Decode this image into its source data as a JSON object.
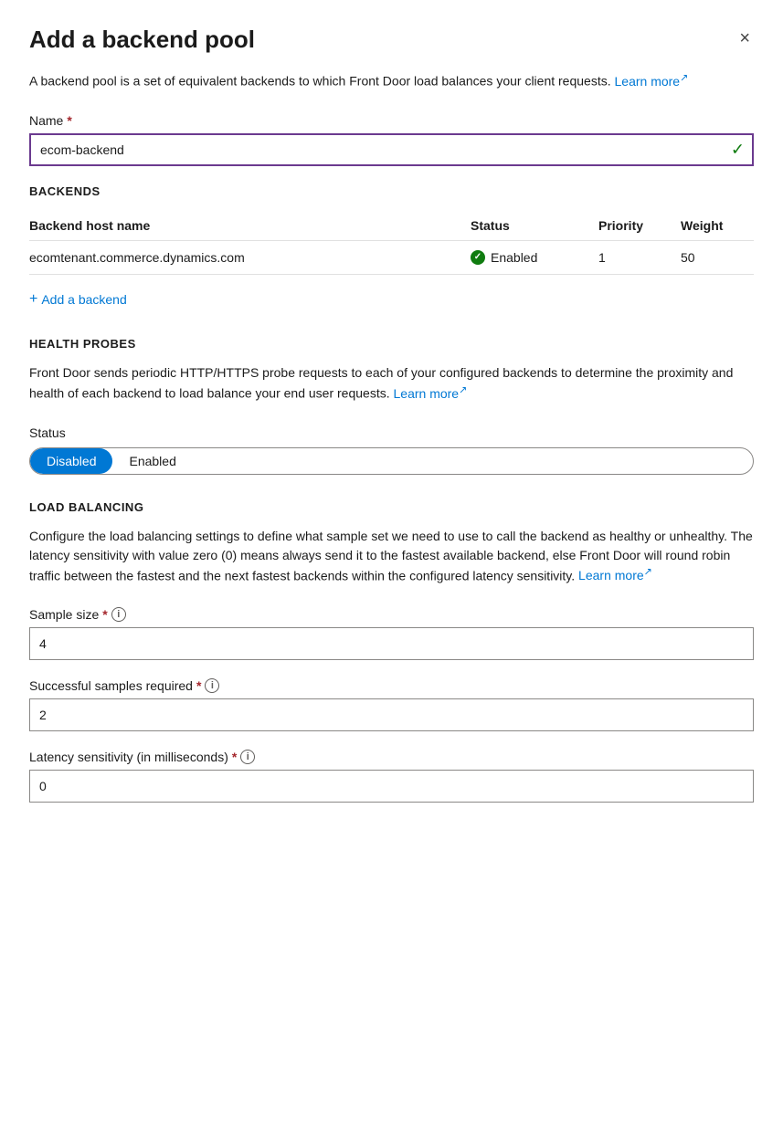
{
  "panel": {
    "title": "Add a backend pool",
    "close_label": "×",
    "description": "A backend pool is a set of equivalent backends to which Front Door load balances your client requests.",
    "learn_more_1": "Learn more",
    "learn_more_ext": "↗"
  },
  "name_field": {
    "label": "Name",
    "required": "*",
    "value": "ecom-backend",
    "placeholder": ""
  },
  "backends_section": {
    "heading": "BACKENDS",
    "table": {
      "columns": [
        "Backend host name",
        "Status",
        "Priority",
        "Weight"
      ],
      "rows": [
        {
          "host": "ecomtenant.commerce.dynamics.com",
          "status": "Enabled",
          "priority": "1",
          "weight": "50"
        }
      ]
    },
    "add_backend_label": "Add a backend"
  },
  "health_probes_section": {
    "heading": "HEALTH PROBES",
    "description": "Front Door sends periodic HTTP/HTTPS probe requests to each of your configured backends to determine the proximity and health of each backend to load balance your end user requests.",
    "learn_more": "Learn more",
    "learn_more_ext": "↗",
    "status_label": "Status",
    "toggle": {
      "disabled_label": "Disabled",
      "enabled_label": "Enabled",
      "active": "disabled"
    }
  },
  "load_balancing_section": {
    "heading": "LOAD BALANCING",
    "description": "Configure the load balancing settings to define what sample set we need to use to call the backend as healthy or unhealthy. The latency sensitivity with value zero (0) means always send it to the fastest available backend, else Front Door will round robin traffic between the fastest and the next fastest backends within the configured latency sensitivity.",
    "learn_more": "Learn more",
    "learn_more_ext": "↗",
    "sample_size": {
      "label": "Sample size",
      "required": "*",
      "value": "4"
    },
    "successful_samples": {
      "label": "Successful samples required",
      "required": "*",
      "value": "2"
    },
    "latency_sensitivity": {
      "label": "Latency sensitivity (in milliseconds)",
      "required": "*",
      "value": "0"
    }
  }
}
